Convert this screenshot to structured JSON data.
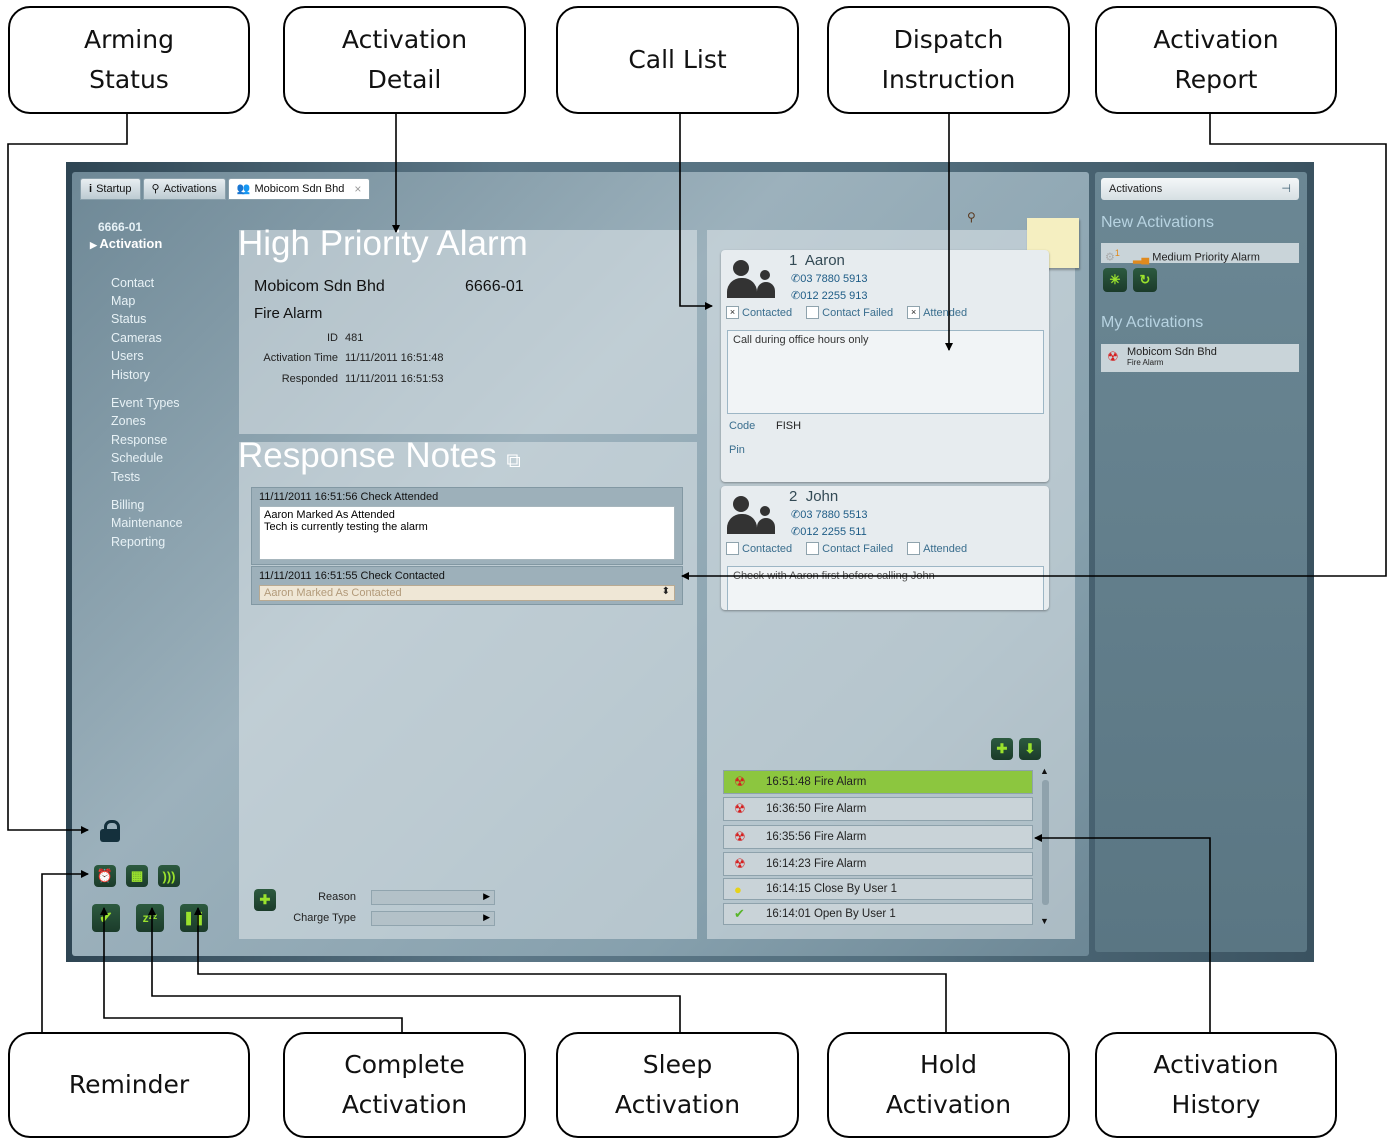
{
  "callouts": {
    "arming_status": "Arming\nStatus",
    "activation_detail": "Activation\nDetail",
    "call_list": "Call List",
    "dispatch_instruction": "Dispatch\nInstruction",
    "activation_report": "Activation\nReport",
    "reminder": "Reminder",
    "complete_activation": "Complete\nActivation",
    "sleep_activation": "Sleep\nActivation",
    "hold_activation": "Hold\nActivation",
    "activation_history": "Activation\nHistory"
  },
  "tabs": [
    {
      "label": "Startup",
      "icon": "info-icon"
    },
    {
      "label": "Activations",
      "icon": "antenna-icon"
    },
    {
      "label": "Mobicom Sdn Bhd",
      "icon": "users-icon",
      "close": "×"
    }
  ],
  "nav": {
    "account": "6666-01",
    "active": "Activation",
    "items": [
      "Contact",
      "Map",
      "Status",
      "Cameras",
      "Users",
      "History",
      "Event Types",
      "Zones",
      "Response",
      "Schedule",
      "Tests",
      "Billing",
      "Maintenance",
      "Reporting"
    ]
  },
  "detail": {
    "title": "High Priority Alarm",
    "company": "Mobicom Sdn Bhd",
    "account": "6666-01",
    "event": "Fire Alarm",
    "id_label": "ID",
    "id_value": "481",
    "act_time_label": "Activation Time",
    "act_time_value": "11/11/2011 16:51:48",
    "responded_label": "Responded",
    "responded_value": "11/11/2011 16:51:53"
  },
  "notes": {
    "title": "Response Notes",
    "entries": [
      {
        "header": "11/11/2011 16:51:56 Check Attended",
        "lines": [
          "Aaron Marked As Attended",
          "Tech is currently testing the alarm"
        ]
      },
      {
        "header": "11/11/2011 16:51:55 Check Contacted",
        "select": "Aaron Marked As Contacted"
      }
    ],
    "reason_label": "Reason",
    "charge_label": "Charge Type"
  },
  "contacts": [
    {
      "num": "1",
      "name": "Aaron",
      "phone1": "03 7880 5913",
      "phone2": "012 2255 913",
      "contacted": "Contacted",
      "failed": "Contact Failed",
      "attended": "Attended",
      "contacted_checked": "×",
      "failed_checked": "",
      "attended_checked": "×",
      "instruction": "Call during office hours only",
      "code_label": "Code",
      "code": "FISH",
      "pin_label": "Pin"
    },
    {
      "num": "2",
      "name": "John",
      "phone1": "03 7880 5513",
      "phone2": "012 2255 511",
      "contacted": "Contacted",
      "failed": "Contact Failed",
      "attended": "Attended",
      "contacted_checked": "",
      "failed_checked": "",
      "attended_checked": "",
      "instruction": "Check with Aaron first before calling John"
    }
  ],
  "history": [
    {
      "time": "16:51:48",
      "label": "Fire Alarm"
    },
    {
      "time": "16:36:50",
      "label": "Fire Alarm"
    },
    {
      "time": "16:35:56",
      "label": "Fire Alarm"
    },
    {
      "time": "16:14:23",
      "label": "Fire Alarm"
    },
    {
      "time": "16:14:15",
      "label": "Close By User 1"
    },
    {
      "time": "16:14:01",
      "label": "Open By User 1"
    }
  ],
  "right": {
    "header": "Activations",
    "new_title": "New Activations",
    "new_badge": "1",
    "new_item": "Medium Priority Alarm",
    "my_title": "My Activations",
    "my_item_company": "Mobicom Sdn Bhd",
    "my_item_event": "Fire Alarm"
  },
  "icons": {
    "lock": "🔒",
    "phone": "📞",
    "alarm": "⏰",
    "fire": "☢",
    "check": "✔",
    "sleep": "zᶻᶻ",
    "pause": "❚❚",
    "plus": "✚",
    "download": "⬇"
  }
}
